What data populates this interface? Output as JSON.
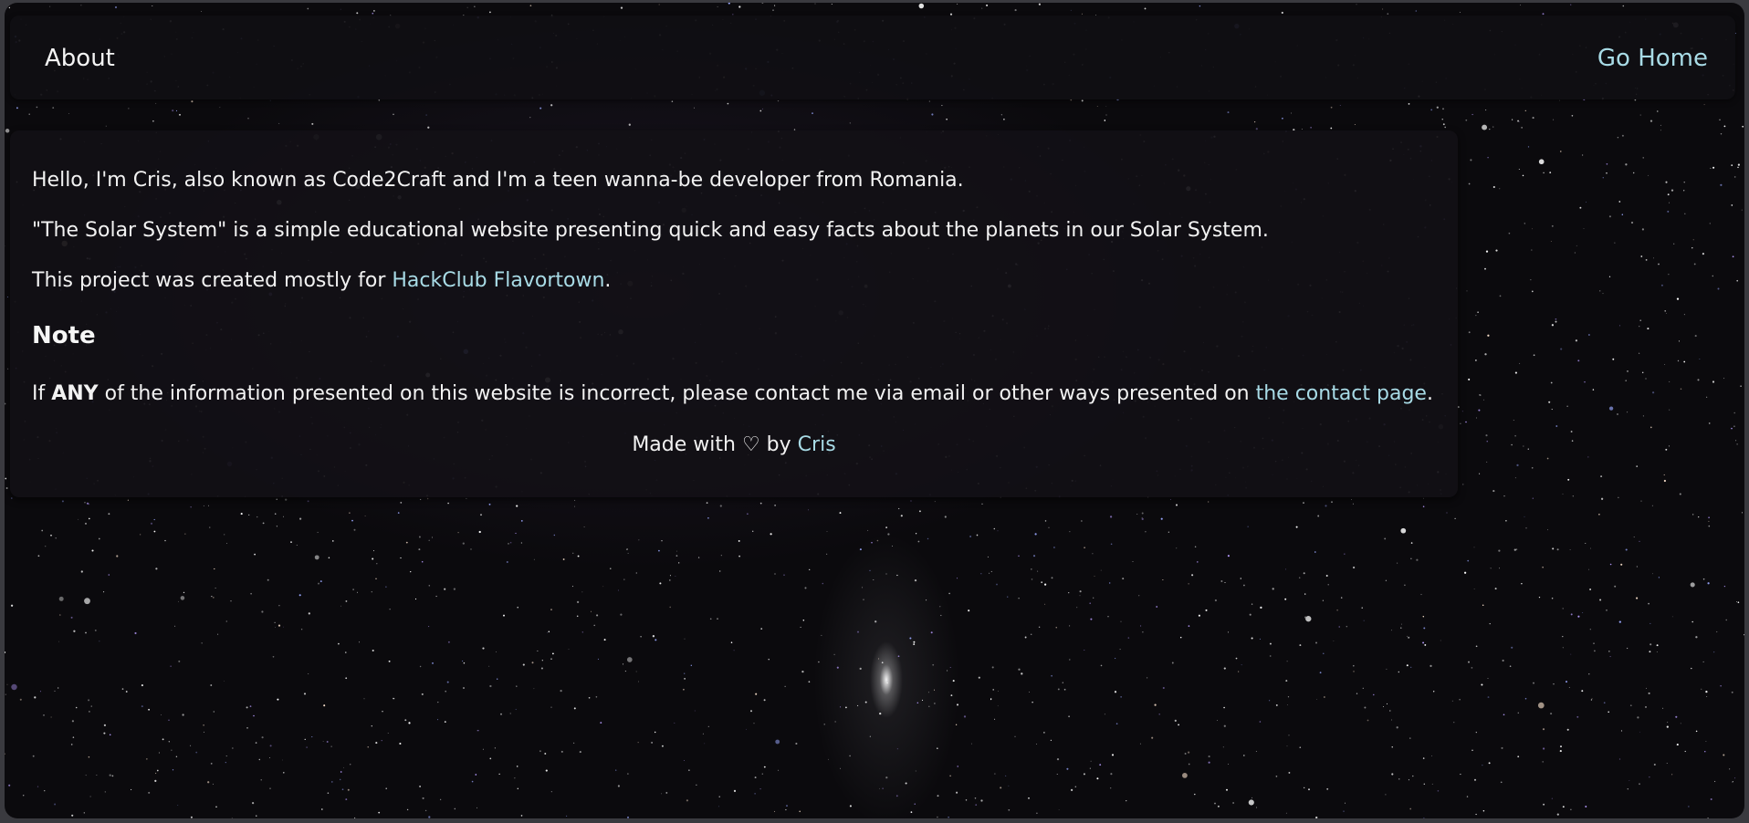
{
  "header": {
    "title": "About",
    "home_link": "Go Home"
  },
  "content": {
    "intro": "Hello, I'm Cris, also known as Code2Craft and I'm a teen wanna-be developer from Romania.",
    "description": "\"The Solar System\" is a simple educational website presenting quick and easy facts about the planets in our Solar System.",
    "project_prefix": "This project was created mostly for ",
    "project_link": "HackClub Flavortown",
    "project_suffix": ".",
    "note_heading": "Note",
    "note_prefix": "If ",
    "note_emphasis": "ANY",
    "note_middle": " of the information presented on this website is incorrect, please contact me via email or other ways presented on ",
    "note_link": "the contact page",
    "note_suffix": "."
  },
  "footer": {
    "made_with": "Made with ",
    "heart": "♡",
    "by": " by ",
    "author_link": "Cris"
  },
  "theme": {
    "link_color": "#a8dbe6",
    "panel_color": "#121016",
    "background": "#0b0a0d"
  }
}
